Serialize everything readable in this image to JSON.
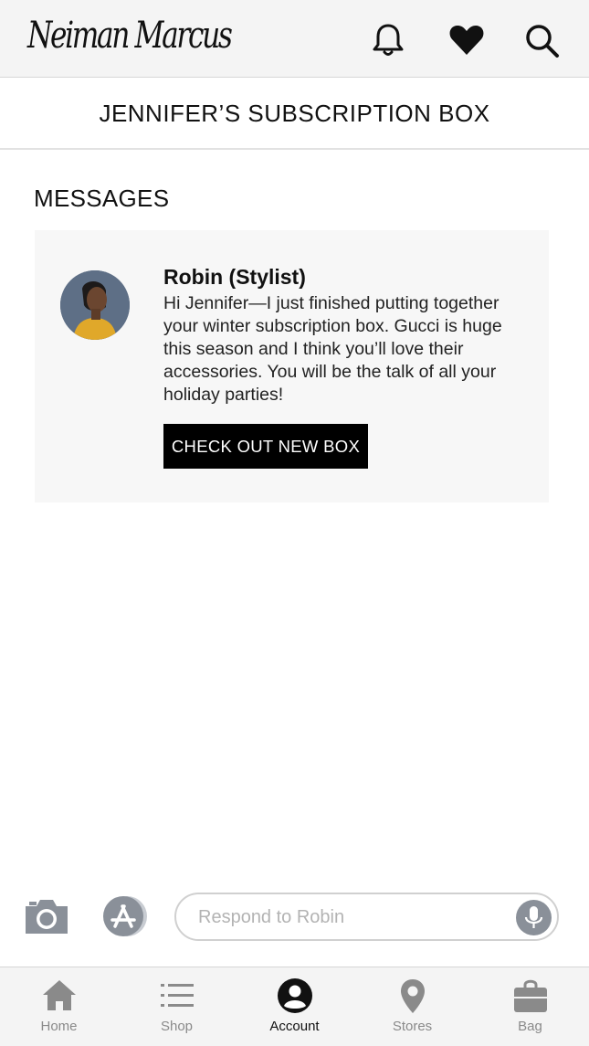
{
  "header": {
    "logo_text": "Neiman Marcus",
    "icons": [
      "bell-icon",
      "heart-icon",
      "search-icon"
    ]
  },
  "page_title": "JENNIFER’S SUBSCRIPTION BOX",
  "messages": {
    "heading": "MESSAGES",
    "items": [
      {
        "sender": "Robin (Stylist)",
        "body": "Hi Jennifer—I just finished putting together your winter subscription box. Gucci is huge this season and I think you’ll love their accessories. You will be the talk of all your holiday parties!",
        "cta_label": "CHECK OUT NEW BOX"
      }
    ]
  },
  "composer": {
    "placeholder": "Respond to Robin",
    "icons": [
      "camera-icon",
      "app-store-icon",
      "microphone-icon"
    ]
  },
  "tabbar": {
    "active": "Account",
    "tabs": [
      {
        "label": "Home",
        "icon": "home-icon"
      },
      {
        "label": "Shop",
        "icon": "list-icon"
      },
      {
        "label": "Account",
        "icon": "account-icon"
      },
      {
        "label": "Stores",
        "icon": "location-pin-icon"
      },
      {
        "label": "Bag",
        "icon": "shopping-bag-icon"
      }
    ]
  },
  "colors": {
    "header_bg": "#f4f4f4",
    "card_bg": "#f7f7f7",
    "cta_bg": "#000000",
    "icon_gray": "#8a9099"
  }
}
